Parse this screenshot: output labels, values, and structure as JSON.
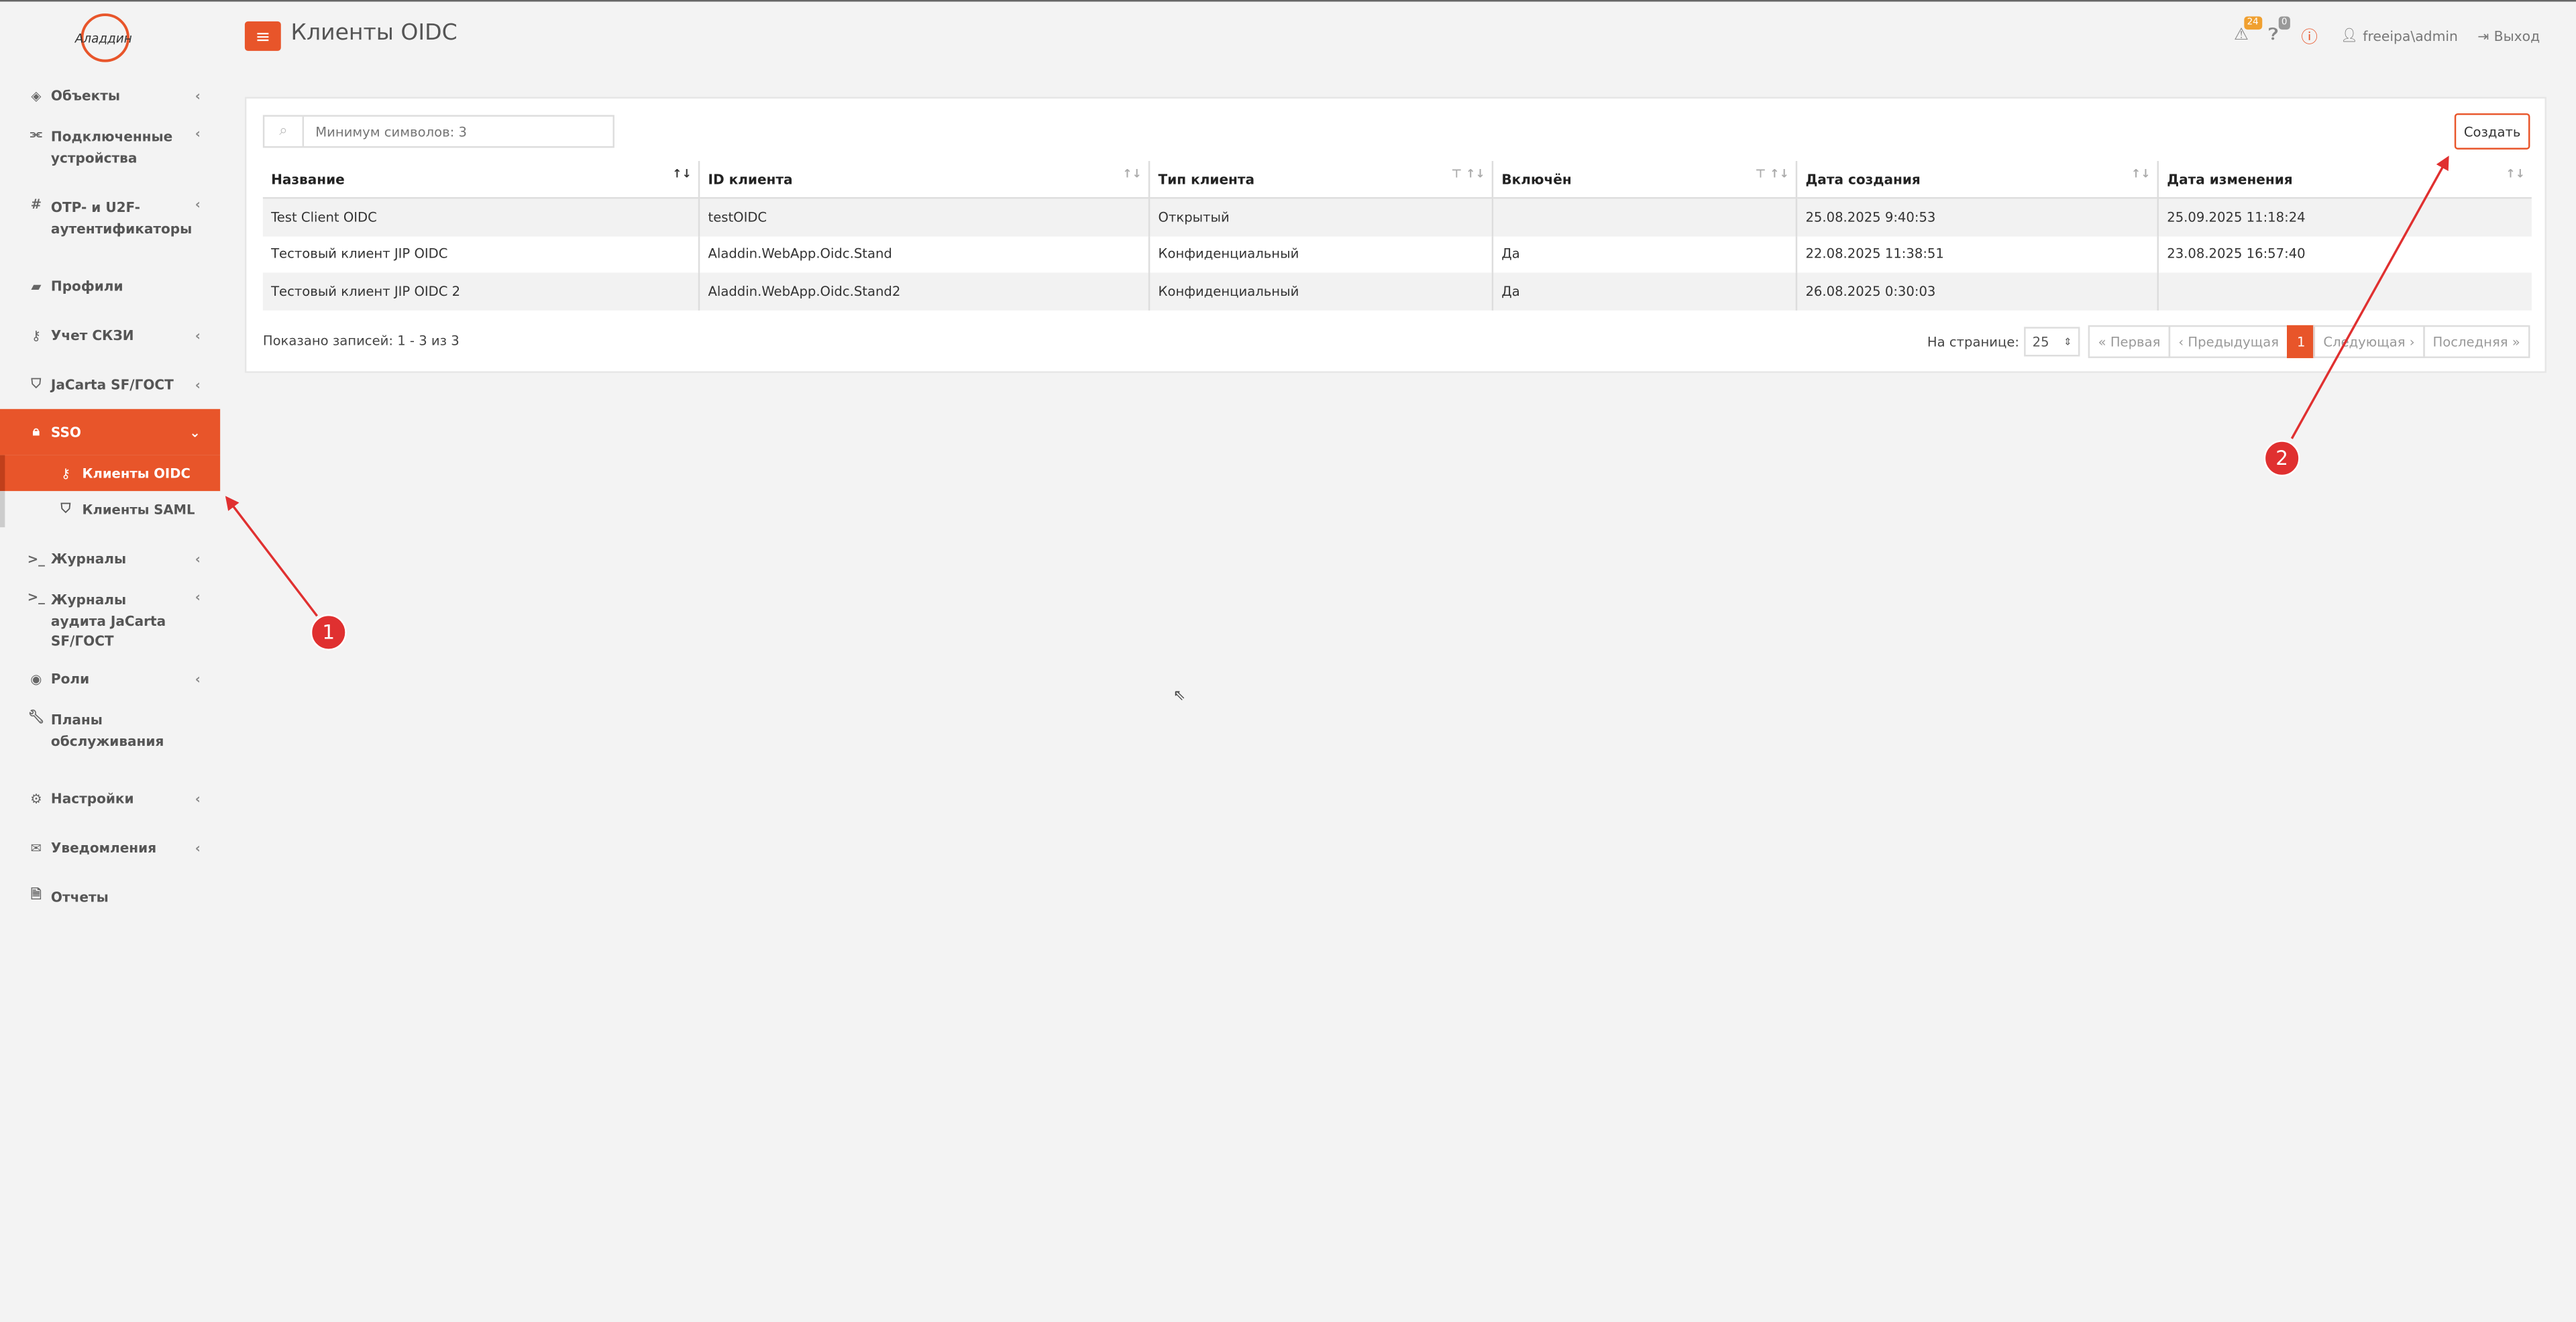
{
  "brand": {
    "logo_text": "Аладдин"
  },
  "header": {
    "title": "Клиенты OIDC",
    "alerts_count": "24",
    "help_count": "0",
    "user": "freeipa\\admin",
    "logout": "Выход"
  },
  "sidebar": {
    "items": [
      {
        "label": "Объекты",
        "icon": "diamond-icon"
      },
      {
        "label": "Подключенные устройства",
        "icon": "usb-icon"
      },
      {
        "label": "OTP- и U2F-аутентификаторы",
        "icon": "hash-icon"
      },
      {
        "label": "Профили",
        "icon": "folder-icon"
      },
      {
        "label": "Учет СКЗИ",
        "icon": "key-icon"
      },
      {
        "label": "JaCarta SF/ГОСТ",
        "icon": "shield-icon"
      },
      {
        "label": "SSO",
        "icon": "lock-icon"
      },
      {
        "label": "Журналы",
        "icon": "terminal-icon"
      },
      {
        "label": "Журналы аудита JaCarta SF/ГОСТ",
        "icon": "terminal-icon"
      },
      {
        "label": "Роли",
        "icon": "user-circle-icon"
      },
      {
        "label": "Планы обслуживания",
        "icon": "wrench-icon"
      },
      {
        "label": "Настройки",
        "icon": "gears-icon"
      },
      {
        "label": "Уведомления",
        "icon": "envelope-icon"
      },
      {
        "label": "Отчеты",
        "icon": "file-icon"
      }
    ],
    "sso_sub": [
      {
        "label": "Клиенты OIDC",
        "icon": "key-icon"
      },
      {
        "label": "Клиенты SAML",
        "icon": "shield-icon"
      }
    ]
  },
  "search": {
    "placeholder": "Минимум символов: 3"
  },
  "toolbar": {
    "create_label": "Создать"
  },
  "table": {
    "columns": [
      "Название",
      "ID клиента",
      "Тип клиента",
      "Включён",
      "Дата создания",
      "Дата изменения"
    ],
    "rows": [
      [
        "Test Client OIDC",
        "testOIDC",
        "Открытый",
        "",
        "25.08.2025 9:40:53",
        "25.09.2025 11:18:24"
      ],
      [
        "Тестовый клиент JIP OIDC",
        "Aladdin.WebApp.Oidc.Stand",
        "Конфиденциальный",
        "Да",
        "22.08.2025 11:38:51",
        "23.08.2025 16:57:40"
      ],
      [
        "Тестовый клиент JIP OIDC 2",
        "Aladdin.WebApp.Oidc.Stand2",
        "Конфиденциальный",
        "Да",
        "26.08.2025 0:30:03",
        ""
      ]
    ]
  },
  "footer": {
    "shown": "Показано записей: 1 - 3 из 3",
    "per_page_label": "На странице:",
    "per_page_value": "25",
    "first": "« Первая",
    "prev": "‹ Предыдущая",
    "current_page": "1",
    "next": "Следующая ›",
    "last": "Последняя »"
  },
  "annotations": {
    "marker1": "1",
    "marker2": "2",
    "color": "#e03030"
  }
}
